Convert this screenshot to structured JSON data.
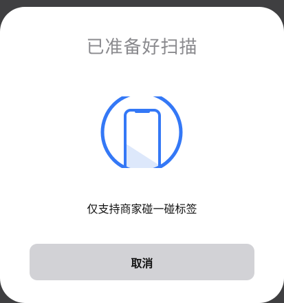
{
  "dialog": {
    "title": "已准备好扫描",
    "graphic_icon": "nfc-phone-scan-icon",
    "hint": "仅支持商家碰一碰标签",
    "cancel_label": "取消"
  },
  "colors": {
    "accent": "#3478f6",
    "title": "#8a8a8e",
    "button_bg": "#d2d2d6",
    "sheet_bg": "#ffffff",
    "backdrop": "#3f3f41"
  }
}
